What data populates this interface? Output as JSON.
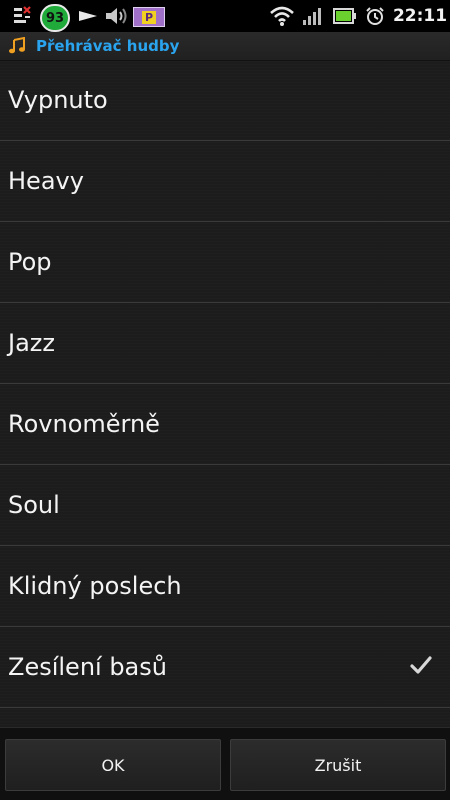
{
  "status_bar": {
    "notification_badge": "93",
    "parking_badge": "P",
    "time": "22:11",
    "icons": [
      "notification-list-icon",
      "play-icon",
      "volume-icon",
      "parking-icon",
      "wifi-icon",
      "signal-icon",
      "battery-icon",
      "alarm-icon"
    ]
  },
  "header": {
    "title": "Přehrávač hudby",
    "icon": "music-note-icon"
  },
  "list": {
    "items": [
      {
        "label": "Vypnuto",
        "selected": false
      },
      {
        "label": "Heavy",
        "selected": false
      },
      {
        "label": "Pop",
        "selected": false
      },
      {
        "label": "Jazz",
        "selected": false
      },
      {
        "label": "Rovnoměrně",
        "selected": false
      },
      {
        "label": "Soul",
        "selected": false
      },
      {
        "label": "Klidný poslech",
        "selected": false
      },
      {
        "label": "Zesílení basů",
        "selected": true
      }
    ]
  },
  "buttons": {
    "ok_label": "OK",
    "cancel_label": "Zrušit"
  },
  "colors": {
    "accent": "#2aa4ee",
    "background": "#1c1c1c",
    "text": "#f4f4f4"
  }
}
